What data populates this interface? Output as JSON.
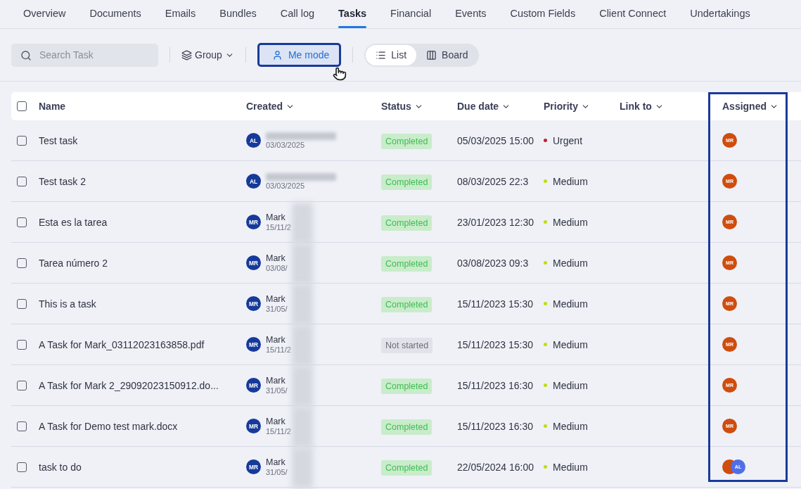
{
  "tabs": [
    {
      "label": "Overview",
      "selected": false
    },
    {
      "label": "Documents",
      "selected": false
    },
    {
      "label": "Emails",
      "selected": false
    },
    {
      "label": "Bundles",
      "selected": false
    },
    {
      "label": "Call log",
      "selected": false
    },
    {
      "label": "Tasks",
      "selected": true
    },
    {
      "label": "Financial",
      "selected": false
    },
    {
      "label": "Events",
      "selected": false
    },
    {
      "label": "Custom Fields",
      "selected": false
    },
    {
      "label": "Client Connect",
      "selected": false
    },
    {
      "label": "Undertakings",
      "selected": false
    }
  ],
  "toolbar": {
    "search": {
      "placeholder": "Search Task"
    },
    "group": "Group",
    "me_mode": {
      "label": "Me mode",
      "selected": true
    },
    "views": [
      {
        "label": "List",
        "selected": true
      },
      {
        "label": "Board",
        "selected": false
      }
    ]
  },
  "table": {
    "select_all_checked": false,
    "columns": [
      "Name",
      "Created",
      "Status",
      "Due date",
      "Priority",
      "Link to",
      "Assigned"
    ],
    "rows": [
      {
        "checked": false,
        "name": "Test task",
        "creator_initials": "AL",
        "created": "03/03/2025",
        "status": "Completed",
        "completed": true,
        "due": "05/03/2025 15:00",
        "priority": "Urgent",
        "color": "#b3262e",
        "assigned": [
          {
            "initials": "MR",
            "color": "#cf4d0e"
          }
        ]
      },
      {
        "checked": false,
        "name": "Test task 2",
        "creator_initials": "AL",
        "created": "03/03/2025",
        "status": "Completed",
        "completed": true,
        "due": "08/03/2025 22:3",
        "priority": "Medium",
        "color": "#c2dc0c",
        "assigned": [
          {
            "initials": "MR",
            "color": "#cf4d0e"
          }
        ]
      },
      {
        "checked": false,
        "name": "Esta es la tarea",
        "creator_initials": "MR",
        "creator_name": "Mark",
        "created": "15/11/2",
        "status": "Completed",
        "completed": true,
        "due": "23/01/2023 12:30",
        "priority": "Medium",
        "color": "#c2dc0c",
        "assigned": [
          {
            "initials": "MR",
            "color": "#cf4d0e"
          }
        ]
      },
      {
        "checked": false,
        "name": "Tarea número 2",
        "creator_initials": "MR",
        "creator_name": "Mark",
        "created": "03/08/",
        "status": "Completed",
        "completed": true,
        "due": "03/08/2023 09:3",
        "priority": "Medium",
        "color": "#c2dc0c",
        "assigned": [
          {
            "initials": "MR",
            "color": "#cf4d0e"
          }
        ]
      },
      {
        "checked": false,
        "name": "This is a task",
        "creator_initials": "MR",
        "creator_name": "Mark",
        "created": "31/05/",
        "status": "Completed",
        "completed": true,
        "due": "15/11/2023 15:30",
        "priority": "Medium",
        "color": "#c2dc0c",
        "assigned": [
          {
            "initials": "MR",
            "color": "#cf4d0e"
          }
        ]
      },
      {
        "checked": false,
        "name": "A Task for Mark_03112023163858.pdf",
        "creator_initials": "MR",
        "creator_name": "Mark",
        "created": "15/11/2",
        "status": "Not started",
        "completed": false,
        "due": "15/11/2023 15:30",
        "priority": "Medium",
        "color": "#c2dc0c",
        "assigned": [
          {
            "initials": "MR",
            "color": "#cf4d0e"
          }
        ]
      },
      {
        "checked": false,
        "name": "A Task for Mark 2_29092023150912.do...",
        "creator_initials": "MR",
        "creator_name": "Mark",
        "created": "31/05/",
        "status": "Completed",
        "completed": true,
        "due": "15/11/2023 16:30",
        "priority": "Medium",
        "color": "#c2dc0c",
        "assigned": [
          {
            "initials": "MR",
            "color": "#cf4d0e"
          }
        ]
      },
      {
        "checked": false,
        "name": "A Task for Demo test mark.docx",
        "creator_initials": "MR",
        "creator_name": "Mark",
        "created": "15/11/2",
        "status": "Completed",
        "completed": true,
        "due": "15/11/2023 16:30",
        "priority": "Medium",
        "color": "#c2dc0c",
        "assigned": [
          {
            "initials": "MR",
            "color": "#cf4d0e"
          }
        ]
      },
      {
        "checked": false,
        "name": "task to do",
        "creator_initials": "MR",
        "creator_name": "Mark",
        "created": "31/05/",
        "status": "Completed",
        "completed": true,
        "due": "22/05/2024 16:00",
        "priority": "Medium",
        "color": "#c2dc0c",
        "assigned": [
          {
            "color": "#cf4d0e"
          },
          {
            "initials": "AL",
            "color": "#4f6ee8"
          }
        ]
      }
    ]
  }
}
